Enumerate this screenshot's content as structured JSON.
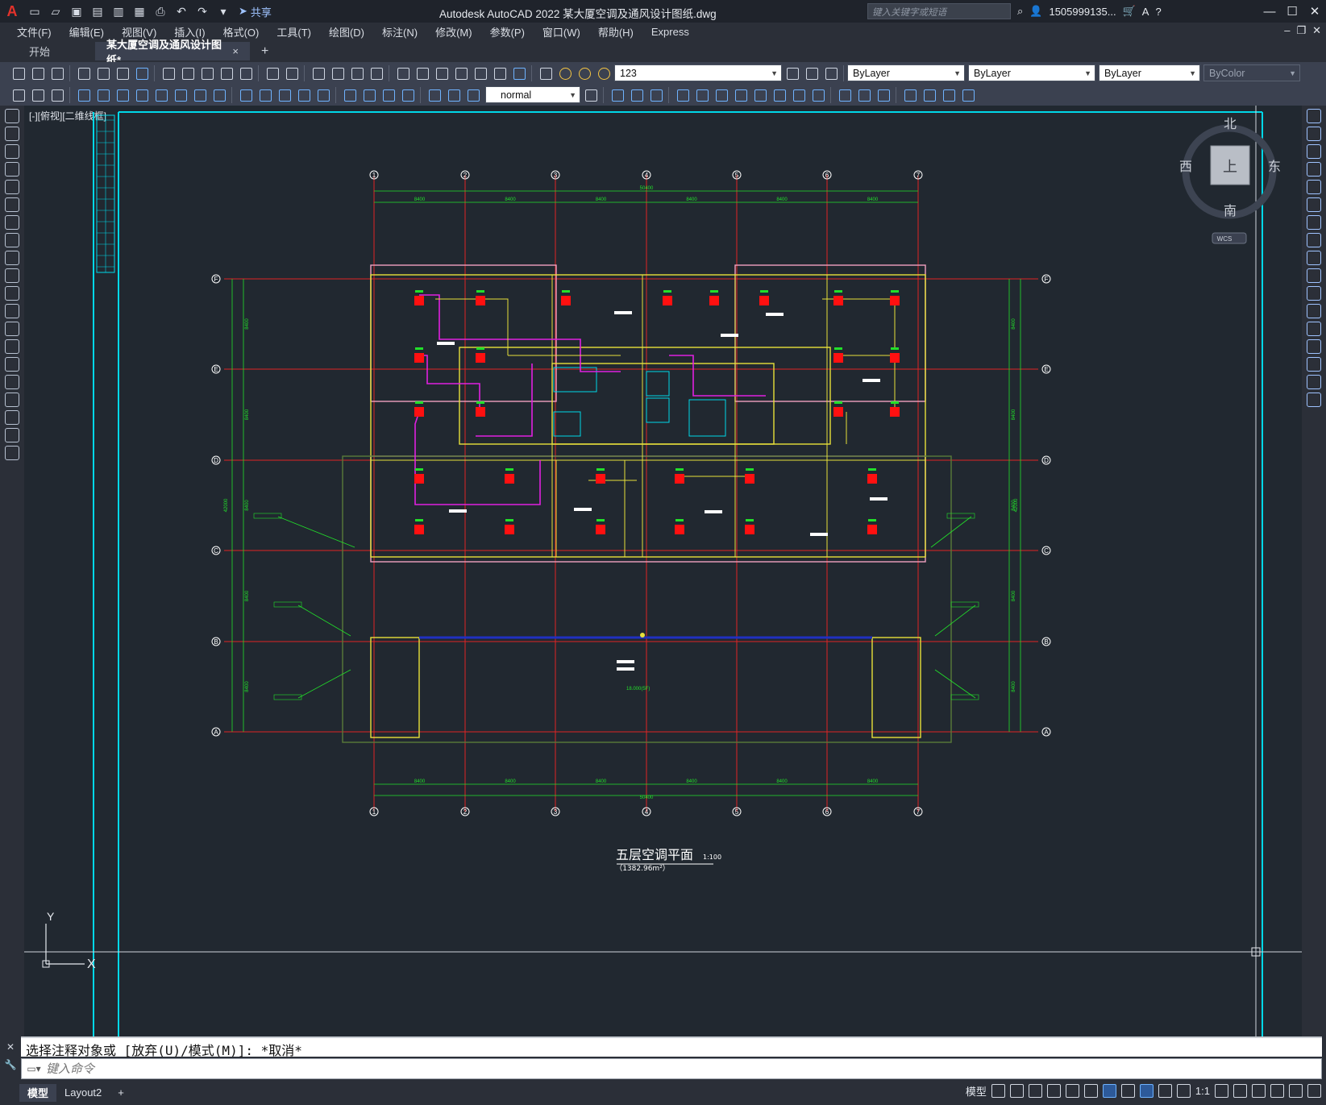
{
  "app": {
    "logo": "A",
    "title": "Autodesk AutoCAD 2022    某大厦空调及通风设计图纸.dwg",
    "share_label": "共享",
    "search_placeholder": "键入关键字或短语",
    "user": "1505999135...",
    "help": "?"
  },
  "menu": [
    "文件(F)",
    "编辑(E)",
    "视图(V)",
    "插入(I)",
    "格式(O)",
    "工具(T)",
    "绘图(D)",
    "标注(N)",
    "修改(M)",
    "参数(P)",
    "窗口(W)",
    "帮助(H)",
    "Express"
  ],
  "tabs": {
    "home": "开始",
    "active": "某大厦空调及通风设计图纸*",
    "close": "×",
    "add": "+"
  },
  "toolbar": {
    "layer_value": "123",
    "color_value": "ByLayer",
    "linetype_value": "ByLayer",
    "lineweight_value": "ByLayer",
    "plotstyle_value": "ByColor",
    "textstyle_value": "normal"
  },
  "viewport": {
    "label": "[-][俯视][二维线框]",
    "viewcube": {
      "north": "北",
      "south": "南",
      "east": "东",
      "west": "西",
      "top": "上",
      "wcs": "WCS"
    },
    "ucs_y": "Y",
    "ucs_x": "X"
  },
  "drawing": {
    "title": "五层空调平面",
    "scale": "1:100",
    "area": "（1382.96m²）",
    "col_labels": [
      "1",
      "2",
      "3",
      "4",
      "5",
      "6",
      "7"
    ],
    "row_labels": [
      "F",
      "E",
      "D",
      "C",
      "B",
      "A"
    ],
    "bay_dims": [
      "8400",
      "8400",
      "8400",
      "8400",
      "8400",
      "8400"
    ],
    "overall_dim": "50400",
    "side_total": "42000",
    "row_dims": [
      "8400",
      "8400",
      "8400",
      "8400",
      "8400"
    ],
    "elev_label": "18.000(5F)"
  },
  "command": {
    "history": "选择注释对象或 [放弃(U)/模式(M)]: *取消*",
    "input_placeholder": "键入命令"
  },
  "status": {
    "model_tab": "模型",
    "layout_tab": "Layout2",
    "add": "+",
    "model_label": "模型",
    "scale": "1:1"
  },
  "colors": {
    "canvas_bg": "#212830",
    "axis_red": "#e02424",
    "dim_green": "#22e02a",
    "wall_yellow": "#e8e03a",
    "duct_magenta": "#e020e0",
    "frame_cyan": "#00d8e8",
    "unit_red": "#ff1010"
  }
}
